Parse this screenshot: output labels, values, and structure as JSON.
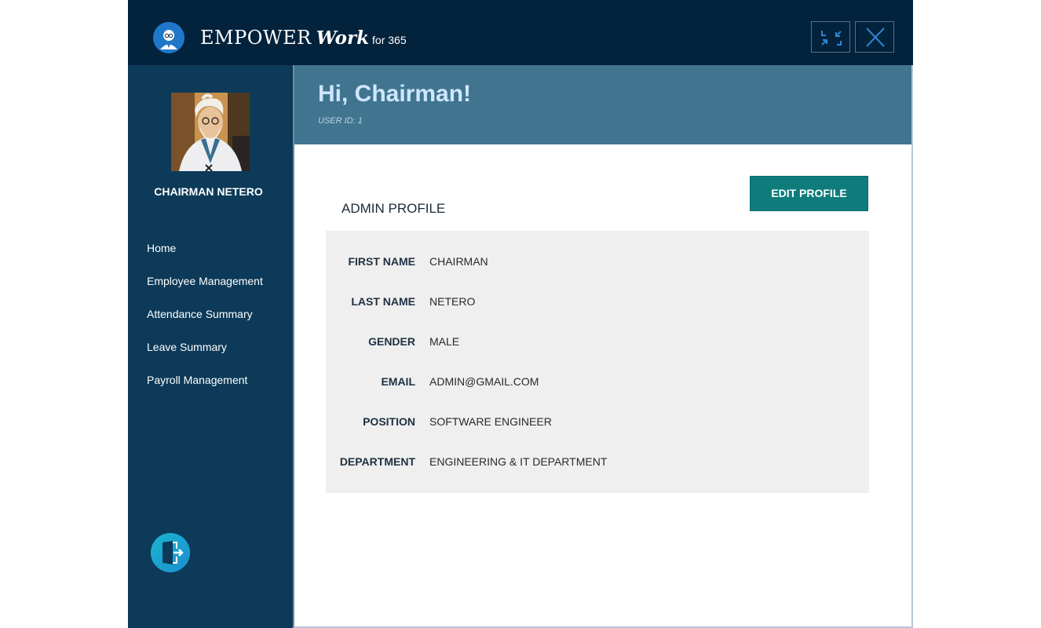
{
  "app": {
    "brand_main": "EMPOWER",
    "brand_work": "Work",
    "brand_suffix": "for 365"
  },
  "colors": {
    "titlebar": "#03223b",
    "sidebar": "#0c3a58",
    "header": "#41758f",
    "accent_button": "#0f7c7c",
    "panel": "#efefef"
  },
  "sidebar": {
    "user_name": "CHAIRMAN NETERO",
    "items": [
      {
        "label": "Home"
      },
      {
        "label": "Employee Management"
      },
      {
        "label": "Attendance Summary"
      },
      {
        "label": "Leave Summary"
      },
      {
        "label": "Payroll Management"
      }
    ],
    "logout_icon": "exit-door-icon"
  },
  "header": {
    "greeting": "Hi, Chairman!",
    "user_id": "USER ID: 1"
  },
  "profile": {
    "title": "ADMIN PROFILE",
    "edit_label": "EDIT PROFILE",
    "fields": [
      {
        "label": "FIRST NAME",
        "value": "CHAIRMAN"
      },
      {
        "label": "LAST NAME",
        "value": "NETERO"
      },
      {
        "label": "GENDER",
        "value": "MALE"
      },
      {
        "label": "EMAIL",
        "value": "ADMIN@GMAIL.COM"
      },
      {
        "label": "POSITION",
        "value": "SOFTWARE ENGINEER"
      },
      {
        "label": "DEPARTMENT",
        "value": "ENGINEERING & IT DEPARTMENT"
      }
    ]
  }
}
